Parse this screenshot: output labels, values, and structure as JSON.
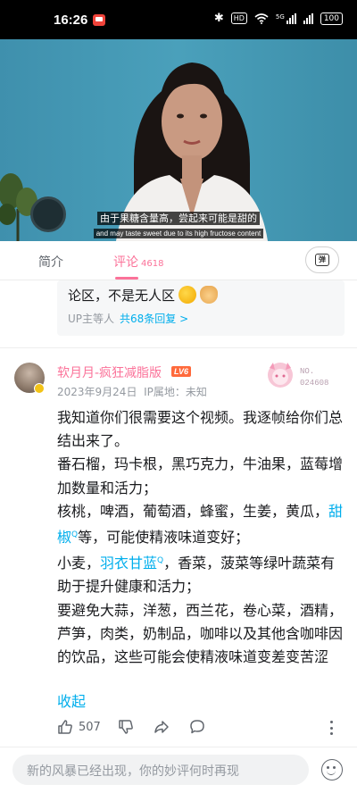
{
  "status_bar": {
    "time": "16:26",
    "hd": "HD",
    "signal_label": "5G",
    "battery": "100"
  },
  "video": {
    "subtitle_cn": "由于果糖含量高，尝起来可能是甜的",
    "subtitle_en": "and may taste sweet due to its high fructose content"
  },
  "tabs": {
    "intro": "简介",
    "comments": "评论",
    "comments_count": "4618",
    "danmaku_icon": "弹"
  },
  "reply_preview": {
    "text": "论区，不是无人区",
    "up_label": "UP主等人",
    "reply_link": "共68条回复 >"
  },
  "comment": {
    "username": "软月月-疯狂减脂版",
    "level": "LV6",
    "date": "2023年9月24日",
    "ip": "IP属地：未知",
    "fan_no_label": "NO.",
    "fan_no": "024608",
    "line1": "我知道你们很需要这个视频。我逐帧给你们总结出来了。",
    "line2": "番石榴，玛卡根，黑巧克力，牛油果，蓝莓增加数量和活力；",
    "line3": "核桃，啤酒，葡萄酒，蜂蜜，生姜，黄瓜，",
    "kw1": "甜椒",
    "line4_rest": "等，可能使精液味道变好；",
    "line5_a": "小麦，",
    "kw2": "羽衣甘蓝",
    "line5_b": "，香菜，菠菜等绿叶蔬菜有助于提升健康和活力；",
    "line6": "要避免大蒜，洋葱，西兰花，卷心菜，酒精，芦笋，肉类，奶制品，咖啡以及其他含咖啡因的饮品，这些可能会使精液味道变差变苦涩",
    "kw_mark": "Q",
    "collapse": "收起",
    "likes": "507"
  },
  "input": {
    "placeholder": "新的风暴已经出现，你的妙评何时再现"
  },
  "colors": {
    "accent_pink": "#fb7299",
    "link_blue": "#00aeec",
    "level_orange": "#ff6a3c"
  },
  "icons": [
    "bluetooth-icon",
    "wifi-icon",
    "signal-icon",
    "battery-icon",
    "danmaku-icon",
    "like-icon",
    "dislike-icon",
    "share-icon",
    "reply-icon",
    "more-icon",
    "emoji-icon"
  ]
}
